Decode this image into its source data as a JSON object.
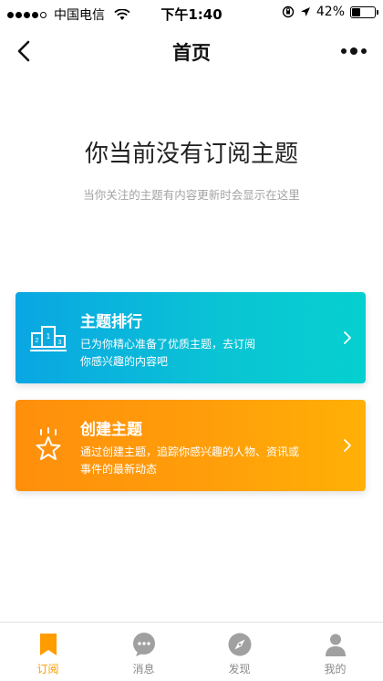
{
  "status_bar": {
    "carrier": "中国电信",
    "time": "下午1:40",
    "battery_text": "42%",
    "battery_level": 0.42,
    "signal_bars": 4
  },
  "nav": {
    "title": "首页"
  },
  "empty_state": {
    "title": "你当前没有订阅主题",
    "subtitle": "当你关注的主题有内容更新时会显示在这里"
  },
  "cards": [
    {
      "title": "主题排行",
      "desc_line1": "已为你精心准备了优质主题，去订阅",
      "desc_line2": "你感兴趣的内容吧",
      "icon": "podium-icon",
      "color": "#0ab6dc"
    },
    {
      "title": "创建主题",
      "desc_line1": "通过创建主题，追踪你感兴趣的人物、资讯或",
      "desc_line2": "事件的最新动态",
      "icon": "star-icon",
      "color": "#ff9a0c"
    }
  ],
  "tabs": [
    {
      "label": "订阅",
      "icon": "bookmark-icon",
      "active": true
    },
    {
      "label": "消息",
      "icon": "chat-icon",
      "active": false
    },
    {
      "label": "发现",
      "icon": "compass-icon",
      "active": false
    },
    {
      "label": "我的",
      "icon": "person-icon",
      "active": false
    }
  ],
  "colors": {
    "accent": "#ff9c00",
    "tab_inactive": "#a0a0a0"
  }
}
